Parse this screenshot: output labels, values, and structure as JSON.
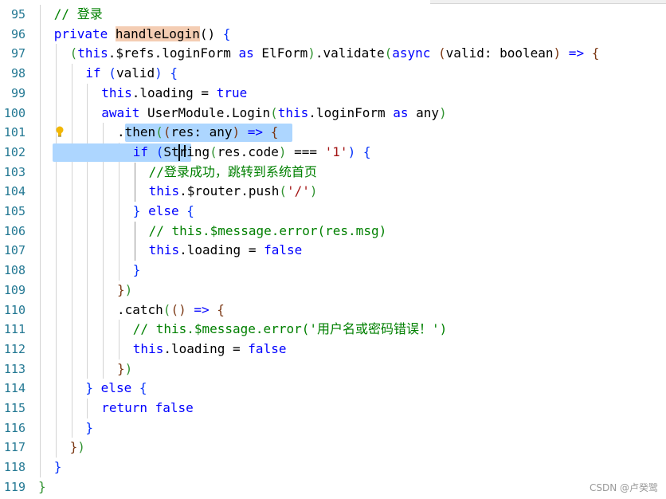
{
  "editor": {
    "lines": [
      {
        "n": "95",
        "indent": 1,
        "tokens": [
          {
            "t": "// 登录",
            "c": "cm"
          }
        ]
      },
      {
        "n": "96",
        "indent": 1,
        "tokens": [
          {
            "t": "private ",
            "c": "kw"
          },
          {
            "t": "handleLogin",
            "c": "hl"
          },
          {
            "t": "() ",
            "c": "op"
          },
          {
            "t": "{",
            "c": "br"
          }
        ]
      },
      {
        "n": "97",
        "indent": 2,
        "tokens": [
          {
            "t": "(",
            "c": "br2"
          },
          {
            "t": "this",
            "c": "kw"
          },
          {
            "t": ".$refs.loginForm ",
            "c": "op"
          },
          {
            "t": "as",
            "c": "kw"
          },
          {
            "t": " ElForm",
            "c": "op"
          },
          {
            "t": ")",
            "c": "br2"
          },
          {
            "t": ".validate",
            "c": "op"
          },
          {
            "t": "(",
            "c": "br2"
          },
          {
            "t": "async",
            "c": "kw"
          },
          {
            "t": " ",
            "c": "op"
          },
          {
            "t": "(",
            "c": "br3"
          },
          {
            "t": "valid: boolean",
            "c": "op"
          },
          {
            "t": ")",
            "c": "br3"
          },
          {
            "t": " => ",
            "c": "kw"
          },
          {
            "t": "{",
            "c": "br3"
          }
        ]
      },
      {
        "n": "98",
        "indent": 3,
        "tokens": [
          {
            "t": "if",
            "c": "kw"
          },
          {
            "t": " ",
            "c": "op"
          },
          {
            "t": "(",
            "c": "br"
          },
          {
            "t": "valid",
            "c": "op"
          },
          {
            "t": ")",
            "c": "br"
          },
          {
            "t": " ",
            "c": "op"
          },
          {
            "t": "{",
            "c": "br"
          }
        ]
      },
      {
        "n": "99",
        "indent": 4,
        "tokens": [
          {
            "t": "this",
            "c": "kw"
          },
          {
            "t": ".loading = ",
            "c": "op"
          },
          {
            "t": "true",
            "c": "kw"
          }
        ]
      },
      {
        "n": "100",
        "indent": 4,
        "tokens": [
          {
            "t": "await",
            "c": "kw"
          },
          {
            "t": " UserModule.Login",
            "c": "op"
          },
          {
            "t": "(",
            "c": "br2"
          },
          {
            "t": "this",
            "c": "kw"
          },
          {
            "t": ".loginForm ",
            "c": "op"
          },
          {
            "t": "as",
            "c": "kw"
          },
          {
            "t": " any",
            "c": "op"
          },
          {
            "t": ")",
            "c": "br2"
          }
        ]
      },
      {
        "n": "101",
        "indent": 5,
        "tokens": [
          {
            "t": ".then",
            "c": "op"
          },
          {
            "t": "(",
            "c": "br2"
          },
          {
            "t": "(",
            "c": "br3"
          },
          {
            "t": "res: any",
            "c": "op"
          },
          {
            "t": ")",
            "c": "br3"
          },
          {
            "t": " => ",
            "c": "kw"
          },
          {
            "t": "{",
            "c": "br3"
          }
        ]
      },
      {
        "n": "102",
        "indent": 6,
        "tokens": [
          {
            "t": "if",
            "c": "kw"
          },
          {
            "t": " ",
            "c": "op"
          },
          {
            "t": "(",
            "c": "br"
          },
          {
            "t": "String",
            "c": "op"
          },
          {
            "t": "(",
            "c": "br2"
          },
          {
            "t": "res.code",
            "c": "op"
          },
          {
            "t": ")",
            "c": "br2"
          },
          {
            "t": " === ",
            "c": "op"
          },
          {
            "t": "'1'",
            "c": "str"
          },
          {
            "t": ")",
            "c": "br"
          },
          {
            "t": " ",
            "c": "op"
          },
          {
            "t": "{",
            "c": "br"
          }
        ]
      },
      {
        "n": "103",
        "indent": 7,
        "tokens": [
          {
            "t": "//登录成功，跳转到系统首页",
            "c": "cm"
          }
        ]
      },
      {
        "n": "104",
        "indent": 7,
        "tokens": [
          {
            "t": "this",
            "c": "kw"
          },
          {
            "t": ".$router.push",
            "c": "op"
          },
          {
            "t": "(",
            "c": "br2"
          },
          {
            "t": "'/'",
            "c": "str"
          },
          {
            "t": ")",
            "c": "br2"
          }
        ]
      },
      {
        "n": "105",
        "indent": 6,
        "tokens": [
          {
            "t": "}",
            "c": "br"
          },
          {
            "t": " ",
            "c": "op"
          },
          {
            "t": "else",
            "c": "kw"
          },
          {
            "t": " ",
            "c": "op"
          },
          {
            "t": "{",
            "c": "br"
          }
        ]
      },
      {
        "n": "106",
        "indent": 7,
        "tokens": [
          {
            "t": "// this.$message.error(res.msg)",
            "c": "cm"
          }
        ]
      },
      {
        "n": "107",
        "indent": 7,
        "tokens": [
          {
            "t": "this",
            "c": "kw"
          },
          {
            "t": ".loading = ",
            "c": "op"
          },
          {
            "t": "false",
            "c": "kw"
          }
        ]
      },
      {
        "n": "108",
        "indent": 6,
        "tokens": [
          {
            "t": "}",
            "c": "br"
          }
        ]
      },
      {
        "n": "109",
        "indent": 5,
        "tokens": [
          {
            "t": "}",
            "c": "br3"
          },
          {
            "t": ")",
            "c": "br2"
          }
        ]
      },
      {
        "n": "110",
        "indent": 5,
        "tokens": [
          {
            "t": ".catch",
            "c": "op"
          },
          {
            "t": "(",
            "c": "br2"
          },
          {
            "t": "(",
            "c": "br3"
          },
          {
            "t": ")",
            "c": "br3"
          },
          {
            "t": " => ",
            "c": "kw"
          },
          {
            "t": "{",
            "c": "br3"
          }
        ]
      },
      {
        "n": "111",
        "indent": 6,
        "tokens": [
          {
            "t": "// this.$message.error('用户名或密码错误！')",
            "c": "cm"
          }
        ]
      },
      {
        "n": "112",
        "indent": 6,
        "tokens": [
          {
            "t": "this",
            "c": "kw"
          },
          {
            "t": ".loading = ",
            "c": "op"
          },
          {
            "t": "false",
            "c": "kw"
          }
        ]
      },
      {
        "n": "113",
        "indent": 5,
        "tokens": [
          {
            "t": "}",
            "c": "br3"
          },
          {
            "t": ")",
            "c": "br2"
          }
        ]
      },
      {
        "n": "114",
        "indent": 3,
        "tokens": [
          {
            "t": "}",
            "c": "br"
          },
          {
            "t": " ",
            "c": "op"
          },
          {
            "t": "else",
            "c": "kw"
          },
          {
            "t": " ",
            "c": "op"
          },
          {
            "t": "{",
            "c": "br"
          }
        ]
      },
      {
        "n": "115",
        "indent": 4,
        "tokens": [
          {
            "t": "return",
            "c": "kw"
          },
          {
            "t": " ",
            "c": "op"
          },
          {
            "t": "false",
            "c": "kw"
          }
        ]
      },
      {
        "n": "116",
        "indent": 3,
        "tokens": [
          {
            "t": "}",
            "c": "br"
          }
        ]
      },
      {
        "n": "117",
        "indent": 2,
        "tokens": [
          {
            "t": "}",
            "c": "br3"
          },
          {
            "t": ")",
            "c": "br2"
          }
        ]
      },
      {
        "n": "118",
        "indent": 1,
        "tokens": [
          {
            "t": "}",
            "c": "br"
          }
        ]
      },
      {
        "n": "119",
        "indent": 0,
        "tokens": [
          {
            "t": "}",
            "c": "br2"
          }
        ]
      }
    ],
    "colors": {
      "keyword": "#0000ff",
      "comment": "#008000",
      "string": "#a31515",
      "line_number": "#237893",
      "selection": "#add6ff",
      "name_highlight": "#f4cdb3"
    },
    "icons": {
      "lightbulb": "lightbulb-icon",
      "cursor": "text-cursor-icon"
    }
  },
  "watermark": "CSDN @卢癸鹭"
}
